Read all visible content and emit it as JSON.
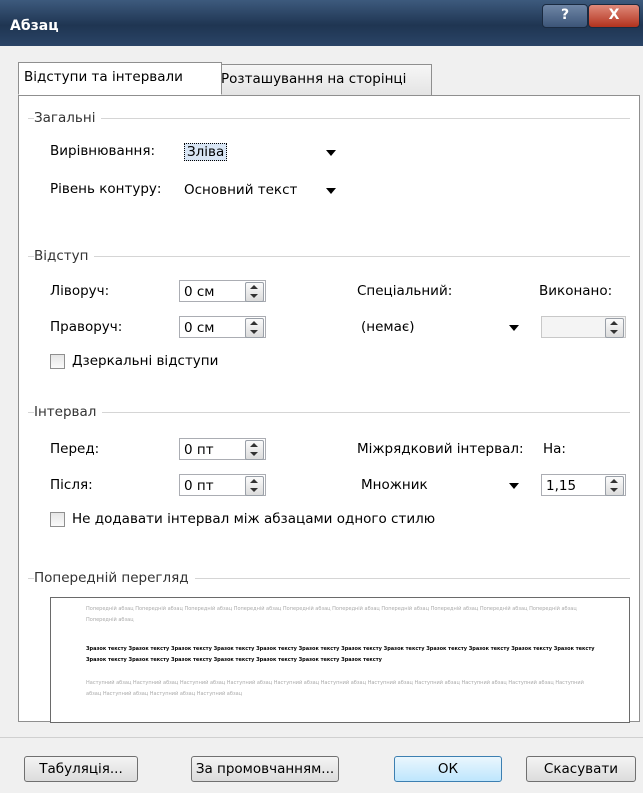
{
  "window": {
    "title": "Абзац",
    "help_label": "?",
    "close_label": "X"
  },
  "tabs": [
    {
      "label": "Відступи та інтервали"
    },
    {
      "label": "Розташування на сторінці"
    }
  ],
  "general": {
    "section_label": "Загальні",
    "alignment_label": "Вирівнювання:",
    "alignment_value": "Зліва",
    "outline_label": "Рівень контуру:",
    "outline_value": "Основний текст"
  },
  "indent": {
    "section_label": "Відступ",
    "left_label": "Ліворуч:",
    "left_value": "0 см",
    "right_label": "Праворуч:",
    "right_value": "0 см",
    "special_label": "Спеціальний:",
    "special_value": "(немає)",
    "by_label": "Виконано:",
    "by_value": "",
    "mirror_label": "Дзеркальні відступи"
  },
  "spacing": {
    "section_label": "Інтервал",
    "before_label": "Перед:",
    "before_value": "0 пт",
    "after_label": "Після:",
    "after_value": "0 пт",
    "line_spacing_label": "Міжрядковий інтервал:",
    "line_spacing_value": "Множник",
    "at_label": "На:",
    "at_value": "1,15",
    "no_space_label": "Не додавати інтервал між абзацами одного стилю"
  },
  "preview": {
    "section_label": "Попередній перегляд",
    "previous_text": "Попередній абзац Попередній абзац Попередній абзац Попередній абзац Попередній абзац Попередній абзац Попередній абзац Попередній абзац Попередній абзац Попередній абзац Попередній абзац",
    "sample_text": "Зразок тексту Зразок тексту Зразок тексту Зразок тексту Зразок тексту Зразок тексту Зразок тексту Зразок тексту Зразок тексту Зразок тексту Зразок тексту Зразок тексту Зразок тексту Зразок тексту Зразок тексту Зразок тексту Зразок тексту Зразок тексту Зразок тексту",
    "next_text": "Наступний абзац Наступний абзац Наступний абзац Наступний абзац Наступний абзац Наступний абзац Наступний абзац Наступний абзац Наступний абзац Наступний абзац Наступний абзац Наступний абзац Наступний абзац Наступний абзац"
  },
  "buttons": {
    "tabs_label": "Табуляція...",
    "default_label": "За промовчанням...",
    "ok_label": "ОК",
    "cancel_label": "Скасувати"
  }
}
